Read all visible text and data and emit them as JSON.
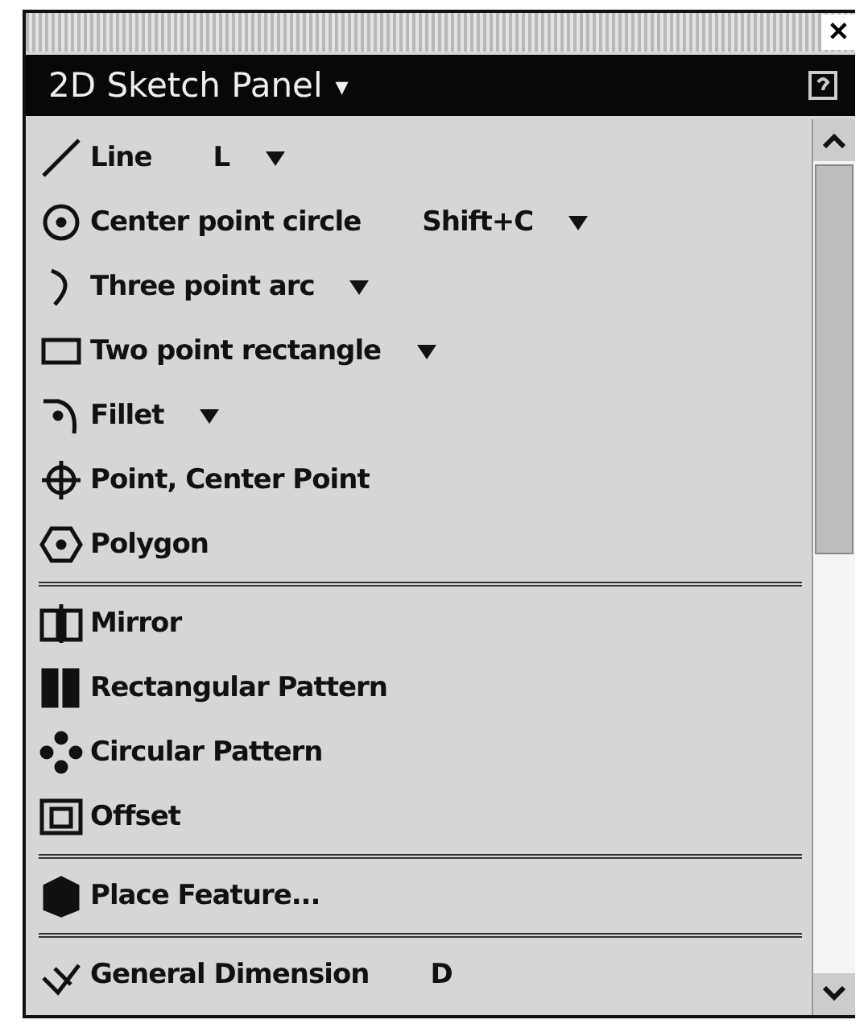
{
  "window": {
    "close": "✕"
  },
  "panel": {
    "title": "2D Sketch Panel",
    "title_menu": "▾"
  },
  "sections": [
    [
      {
        "kind": "line",
        "label": "Line",
        "shortcut": "L",
        "has_menu": true
      },
      {
        "kind": "circle",
        "label": "Center point circle",
        "shortcut": "Shift+C",
        "has_menu": true
      },
      {
        "kind": "arc",
        "label": "Three point arc",
        "has_menu": true
      },
      {
        "kind": "rectangle",
        "label": "Two point rectangle",
        "has_menu": true
      },
      {
        "kind": "fillet",
        "label": "Fillet",
        "has_menu": true
      },
      {
        "kind": "point",
        "label": "Point, Center Point",
        "has_menu": false
      },
      {
        "kind": "polygon",
        "label": "Polygon",
        "has_menu": false
      }
    ],
    [
      {
        "kind": "mirror",
        "label": "Mirror",
        "has_menu": false
      },
      {
        "kind": "rect-pattern",
        "label": "Rectangular Pattern",
        "has_menu": false
      },
      {
        "kind": "circ-pattern",
        "label": "Circular Pattern",
        "has_menu": false
      },
      {
        "kind": "offset",
        "label": "Offset",
        "has_menu": false
      }
    ],
    [
      {
        "kind": "place",
        "label": "Place Feature...",
        "has_menu": false
      }
    ],
    [
      {
        "kind": "dimension",
        "label": "General Dimension",
        "shortcut": "D",
        "has_menu": false
      }
    ]
  ]
}
